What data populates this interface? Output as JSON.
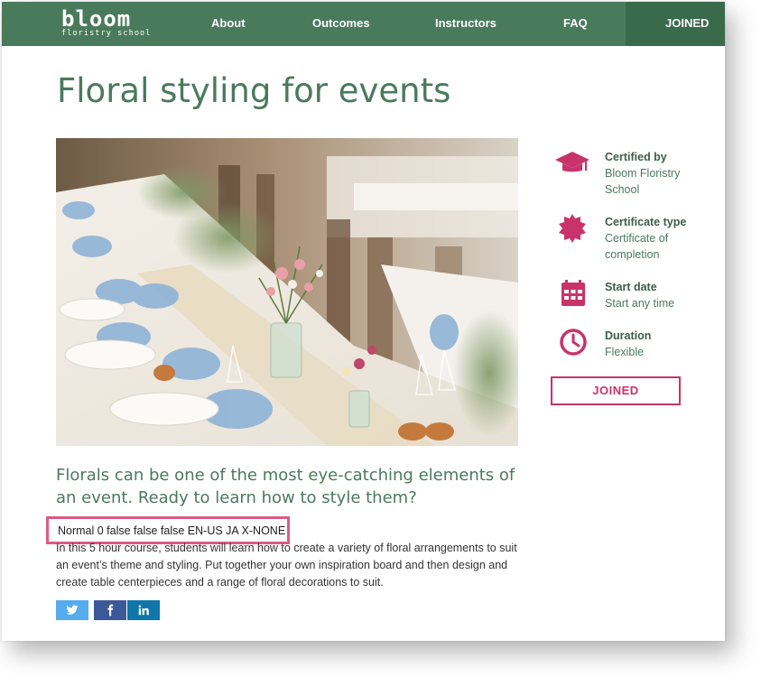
{
  "brand": {
    "name": "bloom",
    "tagline": "floristry school"
  },
  "nav": {
    "links": [
      "About",
      "Outcomes",
      "Instructors",
      "FAQ"
    ],
    "joined_label": "JOINED"
  },
  "course": {
    "title": "Floral styling for events",
    "lead": "Florals can be one of the most eye-catching elements of an event. Ready to learn how to style them?",
    "stray_text": "Normal 0 false false false EN-US JA X-NONE",
    "description": "In this 5 hour course, students will learn how to create a variety of floral arrangements to suit an event’s theme and styling. Put together your own inspiration board and then design and create table centerpieces and a range of floral decorations to suit."
  },
  "share": [
    {
      "icon": "twitter-icon",
      "color": "#55acee"
    },
    {
      "icon": "facebook-icon",
      "color": "#3b5998"
    },
    {
      "icon": "linkedin-icon",
      "color": "#0e76a8"
    }
  ],
  "info": [
    {
      "icon": "graduation-cap-icon",
      "title": "Certified by",
      "value": "Bloom Floristry School"
    },
    {
      "icon": "certificate-seal-icon",
      "title": "Certificate type",
      "value": "Certificate of completion"
    },
    {
      "icon": "calendar-icon",
      "title": "Start date",
      "value": "Start any time"
    },
    {
      "icon": "clock-icon",
      "title": "Duration",
      "value": "Flexible"
    }
  ],
  "joined_button": "JOINED",
  "colors": {
    "brand_green": "#4a7a5c",
    "accent_pink": "#c8336c",
    "highlight_box": "#dd5a87"
  }
}
